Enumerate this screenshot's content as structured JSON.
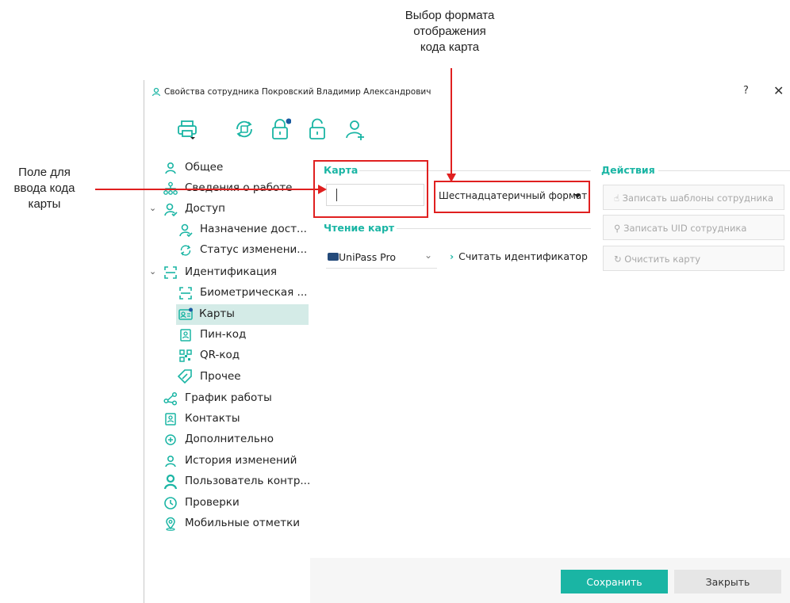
{
  "annotations": {
    "top": [
      "Выбор формата",
      "отображения",
      "кода карта"
    ],
    "left": [
      "Поле для",
      "ввода кода",
      "карты"
    ]
  },
  "window": {
    "title": "Свойства сотрудника Покровский Владимир Александрович",
    "help": "?",
    "close": "✕"
  },
  "toolbar": {
    "icons": [
      "printer-icon",
      "sync-card-icon",
      "lock-status-icon",
      "unlock-icon",
      "add-user-icon"
    ]
  },
  "sidebar": {
    "items": [
      {
        "label": "Общее",
        "icon": "user-icon"
      },
      {
        "label": "Сведения о работе",
        "icon": "org-structure-icon"
      },
      {
        "label": "Доступ",
        "icon": "access-icon",
        "expanded": true
      },
      {
        "label": "Назначение дост...",
        "icon": "access-assign-icon"
      },
      {
        "label": "Статус изменени...",
        "icon": "refresh-icon"
      },
      {
        "label": "Идентификация",
        "icon": "scan-icon",
        "expanded": true
      },
      {
        "label": "Биометрическая ...",
        "icon": "biometric-icon"
      },
      {
        "label": "Карты",
        "icon": "card-icon",
        "selected": true
      },
      {
        "label": "Пин-код",
        "icon": "pin-icon"
      },
      {
        "label": "QR-код",
        "icon": "qr-icon"
      },
      {
        "label": "Прочее",
        "icon": "tag-icon"
      },
      {
        "label": "График работы",
        "icon": "schedule-icon"
      },
      {
        "label": "Контакты",
        "icon": "contacts-icon"
      },
      {
        "label": "Дополнительно",
        "icon": "plus-circle-icon"
      },
      {
        "label": "История изменений",
        "icon": "history-user-icon"
      },
      {
        "label": "Пользователь контр...",
        "icon": "controller-user-icon"
      },
      {
        "label": "Проверки",
        "icon": "clock-icon"
      },
      {
        "label": "Мобильные отметки",
        "icon": "location-icon"
      }
    ]
  },
  "card_section": {
    "title": "Карта",
    "input_value": "",
    "format": "Шестнадцатеричный формат"
  },
  "reading_section": {
    "title": "Чтение карт",
    "reader": "UniPass Pro",
    "read_button": "Считать идентификатор"
  },
  "actions_section": {
    "title": "Действия",
    "buttons": [
      "Записать шаблоны сотрудника",
      "Записать UID сотрудника",
      "Очистить карту"
    ]
  },
  "footer": {
    "save": "Сохранить",
    "close": "Закрыть"
  },
  "colors": {
    "accent": "#1ab5a4",
    "annotation": "#e02020",
    "selected_bg": "#d4ebe7"
  }
}
